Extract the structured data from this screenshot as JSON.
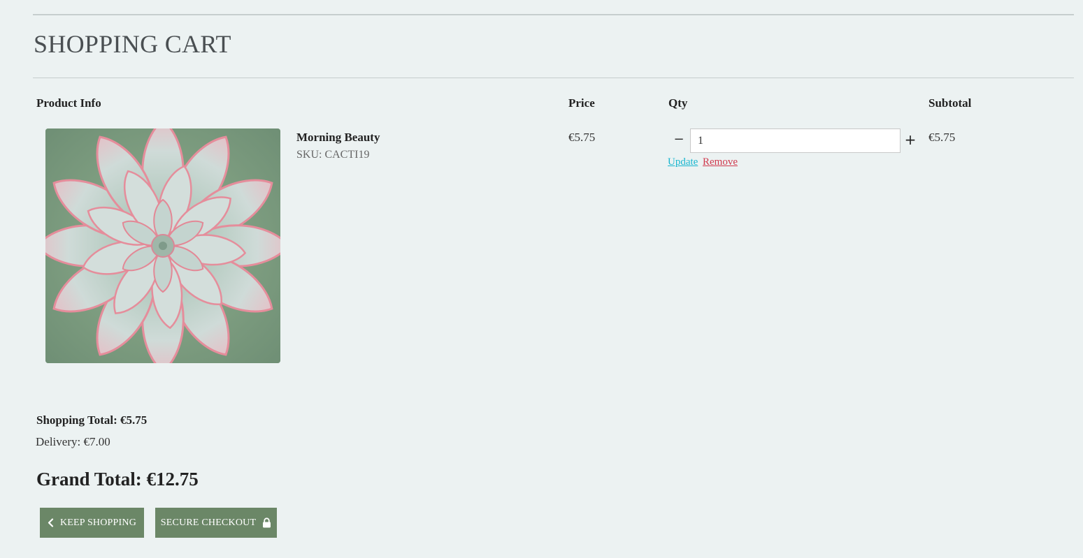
{
  "page": {
    "title": "SHOPPING CART"
  },
  "table": {
    "headers": {
      "product": "Product Info",
      "price": "Price",
      "qty": "Qty",
      "subtotal": "Subtotal"
    }
  },
  "item": {
    "name": "Morning Beauty",
    "sku": "SKU: CACTI19",
    "price": "€5.75",
    "qty": "1",
    "subtotal": "€5.75",
    "minus_label": "−",
    "plus_label": "+",
    "update_label": "Update",
    "remove_label": "Remove",
    "image_icon": "succulent-photo"
  },
  "totals": {
    "shopping_total": "Shopping Total: €5.75",
    "delivery": "Delivery: €7.00",
    "grand_total": "Grand Total: €12.75"
  },
  "buttons": {
    "keep_shopping": "KEEP SHOPPING",
    "keep_shopping_icon": "chevron-left-icon",
    "secure_checkout": "SECURE CHECKOUT",
    "secure_checkout_icon": "lock-icon"
  },
  "colors": {
    "background": "#ecf2f2",
    "button": "#6b8767",
    "update_link": "#17b6cf",
    "remove_link": "#d0394d"
  }
}
